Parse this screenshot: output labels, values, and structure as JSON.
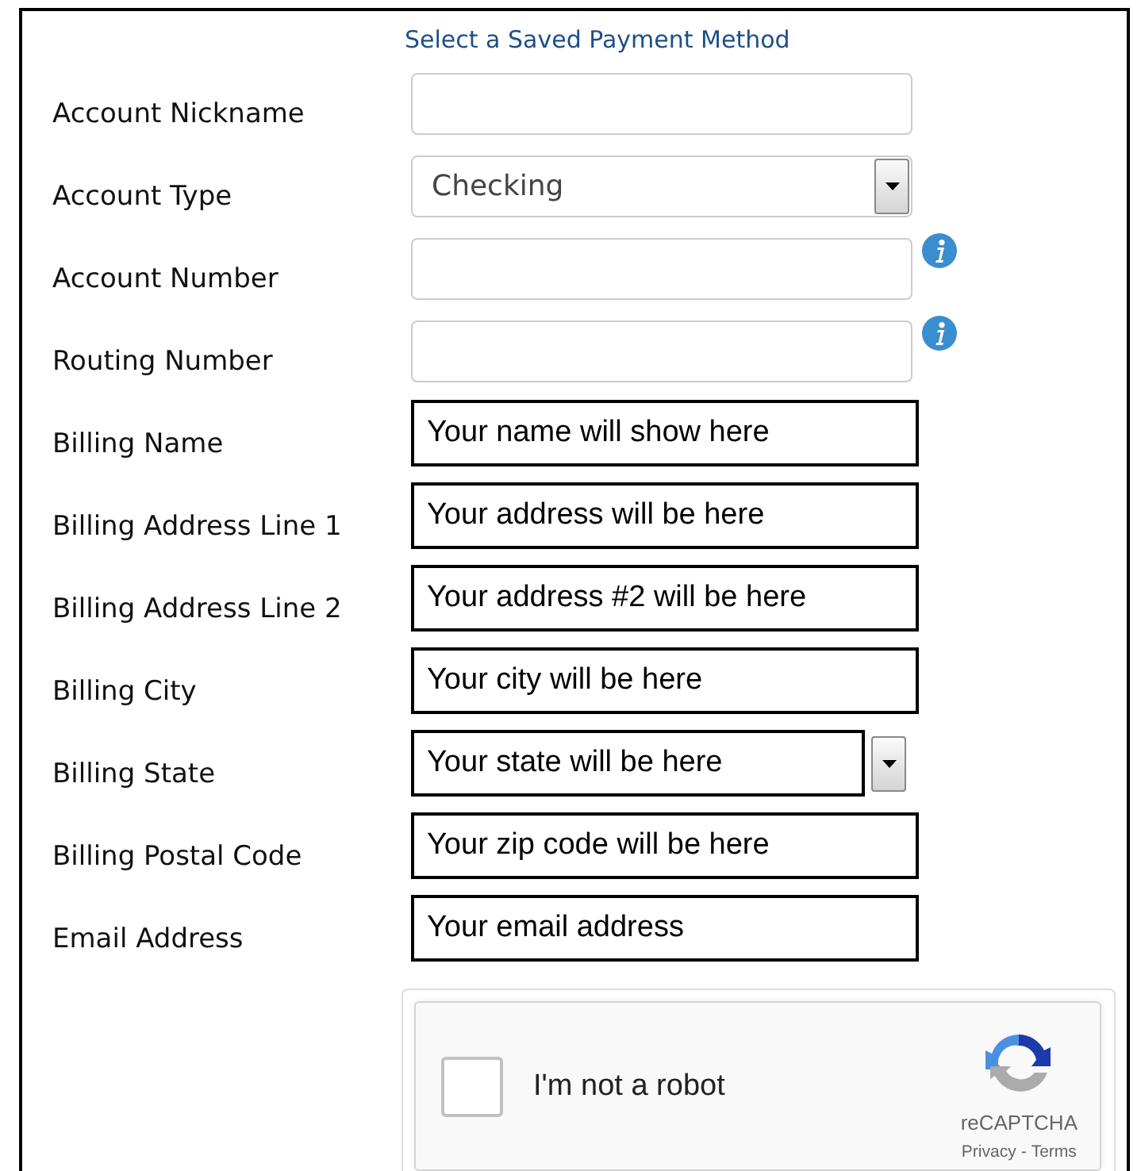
{
  "header_link": "Select a Saved Payment Method",
  "fields": [
    {
      "label": "Account Nickname",
      "kind": "text",
      "marked": false,
      "info": false
    },
    {
      "label": "Account Type",
      "kind": "select",
      "marked": false,
      "info": false,
      "value": "Checking"
    },
    {
      "label": "Account Number",
      "kind": "text",
      "marked": false,
      "info": true
    },
    {
      "label": "Routing Number",
      "kind": "text",
      "marked": false,
      "info": true
    },
    {
      "label": "Billing Name",
      "kind": "text",
      "marked": true,
      "info": false,
      "value": "Your name will show here"
    },
    {
      "label": "Billing Address Line 1",
      "kind": "text",
      "marked": true,
      "info": false,
      "value": "Your address will be here"
    },
    {
      "label": "Billing Address Line 2",
      "kind": "text",
      "marked": true,
      "info": false,
      "value": "Your address #2 will be here"
    },
    {
      "label": "Billing City",
      "kind": "text",
      "marked": true,
      "info": false,
      "value": "Your city will be here"
    },
    {
      "label": "Billing State",
      "kind": "select",
      "marked": true,
      "info": false,
      "value": "Your state will be here"
    },
    {
      "label": "Billing Postal Code",
      "kind": "text",
      "marked": true,
      "info": false,
      "value": "Your zip code will be here"
    },
    {
      "label": "Email Address",
      "kind": "text",
      "marked": true,
      "info": false,
      "value": "Your email address"
    }
  ],
  "captcha": {
    "checked": false,
    "label": "I'm not a robot",
    "brand": "reCAPTCHA",
    "links": [
      "Privacy",
      "Terms"
    ],
    "separator": "-"
  }
}
